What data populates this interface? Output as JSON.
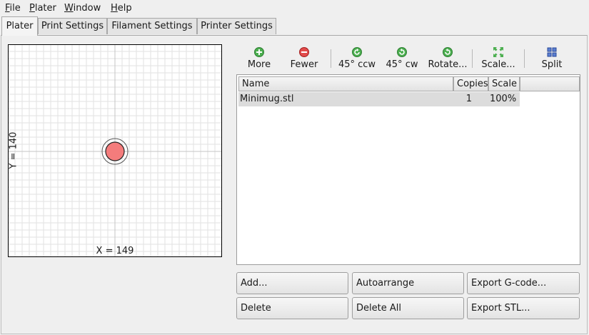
{
  "menu": [
    {
      "mnemonic": "F",
      "rest": "ile"
    },
    {
      "mnemonic": "P",
      "rest": "later"
    },
    {
      "mnemonic": "W",
      "rest": "indow"
    },
    {
      "mnemonic": "H",
      "rest": "elp"
    }
  ],
  "tabs": [
    "Plater",
    "Print Settings",
    "Filament Settings",
    "Printer Settings"
  ],
  "active_tab": "Plater",
  "plater": {
    "x_label": "X = 149",
    "y_label": "Y = 140",
    "object_color": "#f47c7c"
  },
  "toolbar": {
    "more": "More",
    "fewer": "Fewer",
    "rotate_ccw": "45° ccw",
    "rotate_cw": "45° cw",
    "rotate": "Rotate...",
    "scale": "Scale...",
    "split": "Split"
  },
  "object_list": {
    "headers": {
      "name": "Name",
      "copies": "Copies",
      "scale": "Scale"
    },
    "rows": [
      {
        "name": "Minimug.stl",
        "copies": "1",
        "scale": "100%"
      }
    ]
  },
  "buttons": {
    "add": "Add...",
    "autoarrange": "Autoarrange",
    "export_gcode": "Export G-code...",
    "delete": "Delete",
    "delete_all": "Delete All",
    "export_stl": "Export STL..."
  },
  "colors": {
    "add_icon": "#4caf50",
    "remove_icon": "#e24b4b",
    "rotate_icon": "#4caf50"
  }
}
